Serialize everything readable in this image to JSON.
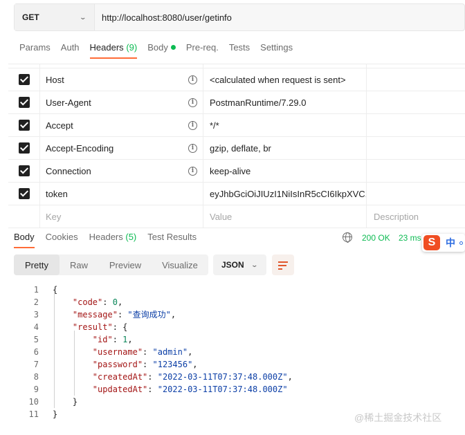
{
  "request": {
    "method": "GET",
    "url": "http://localhost:8080/user/getinfo"
  },
  "request_tabs": [
    {
      "label": "Params",
      "count": "",
      "active": false
    },
    {
      "label": "Auth",
      "count": "",
      "active": false
    },
    {
      "label": "Headers",
      "count": "(9)",
      "active": true
    },
    {
      "label": "Body",
      "count": "",
      "active": false,
      "indicator": "green-dot"
    },
    {
      "label": "Pre-req.",
      "count": "",
      "active": false
    },
    {
      "label": "Tests",
      "count": "",
      "active": false
    },
    {
      "label": "Settings",
      "count": "",
      "active": false
    }
  ],
  "headers": [
    {
      "key": "Host",
      "value": "<calculated when request is sent>",
      "checked": true,
      "auto": true
    },
    {
      "key": "User-Agent",
      "value": "PostmanRuntime/7.29.0",
      "checked": true,
      "auto": true
    },
    {
      "key": "Accept",
      "value": "*/*",
      "checked": true,
      "auto": true
    },
    {
      "key": "Accept-Encoding",
      "value": "gzip, deflate, br",
      "checked": true,
      "auto": true
    },
    {
      "key": "Connection",
      "value": "keep-alive",
      "checked": true,
      "auto": true
    },
    {
      "key": "token",
      "value": "eyJhbGciOiJIUzI1NiIsInR5cCI6IkpXVC...",
      "checked": true,
      "auto": false
    }
  ],
  "headers_placeholder": {
    "key": "Key",
    "value": "Value",
    "description": "Description"
  },
  "response_tabs": [
    {
      "label": "Body",
      "count": "",
      "active": true
    },
    {
      "label": "Cookies",
      "count": "",
      "active": false
    },
    {
      "label": "Headers",
      "count": "(5)",
      "active": false
    },
    {
      "label": "Test Results",
      "count": "",
      "active": false
    }
  ],
  "response_meta": {
    "status": "200 OK",
    "time": "23 ms"
  },
  "ime": {
    "logo": "S",
    "mode": "中"
  },
  "view_modes": [
    "Pretty",
    "Raw",
    "Preview",
    "Visualize"
  ],
  "active_view": "Pretty",
  "format": "JSON",
  "response_body": {
    "code": 0,
    "message": "查询成功",
    "result": {
      "id": 1,
      "username": "admin",
      "password": "123456",
      "createdAt": "2022-03-11T07:37:48.000Z",
      "updatedAt": "2022-03-11T07:37:48.000Z"
    }
  },
  "line_numbers": [
    "1",
    "2",
    "3",
    "4",
    "5",
    "6",
    "7",
    "8",
    "9",
    "10",
    "11"
  ],
  "watermark": "@稀土掘金技术社区",
  "colors": {
    "accent": "#ff6c37",
    "success": "#0cbb52",
    "key": "#a31515",
    "string": "#0b3ea6",
    "number": "#098658"
  }
}
